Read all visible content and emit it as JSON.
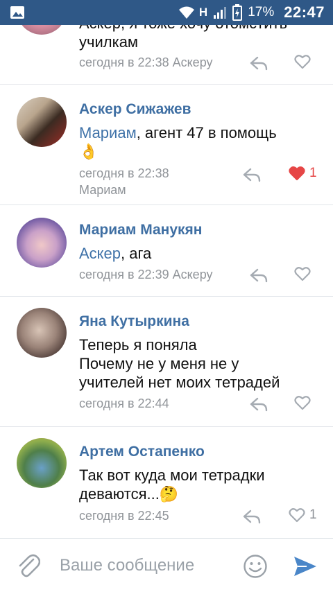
{
  "status_bar": {
    "network": "H",
    "battery": "17%",
    "time": "22:47"
  },
  "comments": [
    {
      "text": "Аскеру, я тоже хочу отомстить училкам",
      "text_line1": "Аскер, я тоже хочу отомстить",
      "text_line2": "училкам",
      "meta": "сегодня в 22:38 Аскеру",
      "likes": ""
    },
    {
      "author": "Аскер Сижажев",
      "mention": "Мариам",
      "text": ", агент 47 в помощь",
      "emoji": "👌",
      "meta_line1": "сегодня в 22:38",
      "meta_line2": "Мариам",
      "likes": "1",
      "liked": true
    },
    {
      "author": "Мариам Манукян",
      "mention": "Аскер",
      "text": ", ага",
      "meta": "сегодня в 22:39 Аскеру",
      "likes": ""
    },
    {
      "author": "Яна Кутыркина",
      "line1": "Теперь я поняла",
      "line2": "Почему не у меня не у",
      "line3": "учителей нет моих тетрадей",
      "meta": "сегодня в 22:44",
      "likes": ""
    },
    {
      "author": "Артем Остапенко",
      "line1": "Так вот куда мои тетрадки",
      "line2": "деваются...",
      "emoji": "🤔",
      "meta": "сегодня в 22:45",
      "likes": "1",
      "liked": false
    }
  ],
  "composer": {
    "placeholder": "Ваше сообщение"
  },
  "icons": {
    "attach": "paperclip-icon",
    "emoji": "smiley-icon",
    "send": "send-arrow-icon",
    "reply": "reply-arrow-icon",
    "like": "heart-icon"
  },
  "colors": {
    "status_bar": "#2f5887",
    "author": "#3f6fa3",
    "meta": "#909499",
    "like_active": "#e64646",
    "send": "#4a86c8"
  }
}
